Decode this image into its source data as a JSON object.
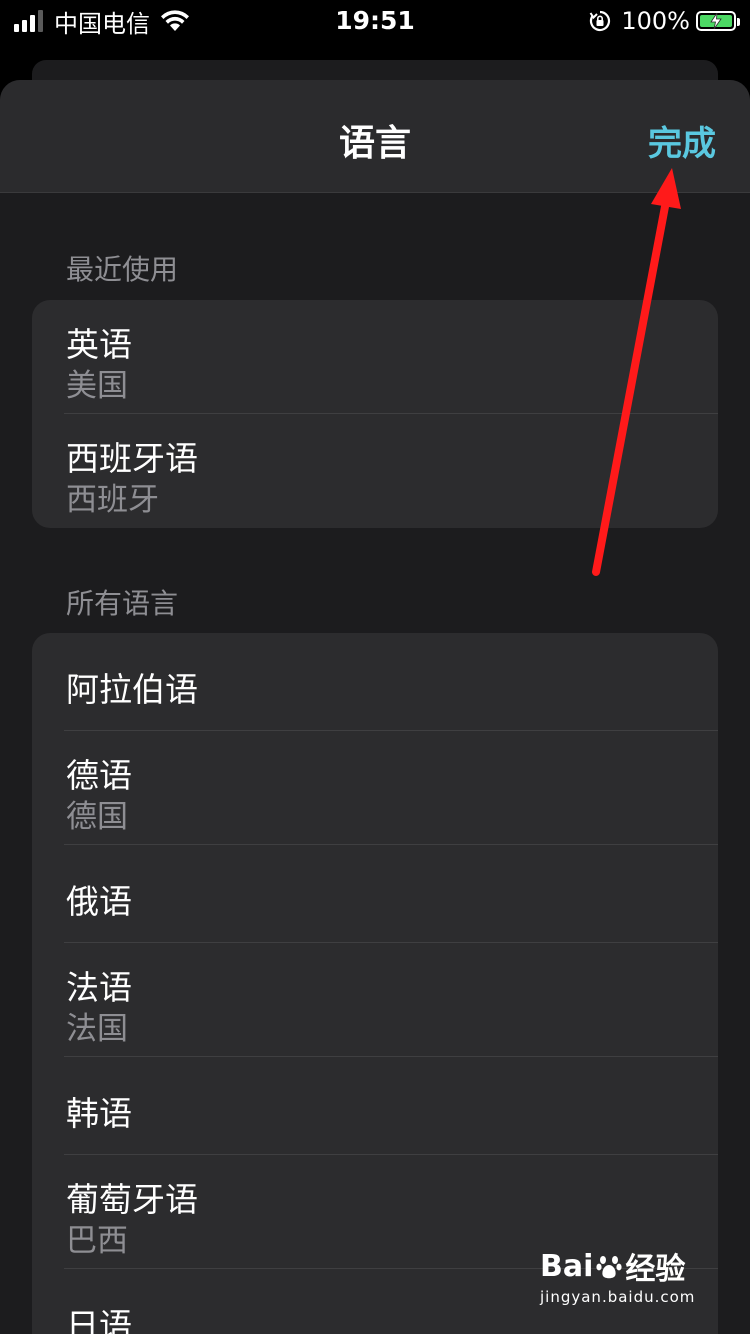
{
  "status_bar": {
    "carrier": "中国电信",
    "time": "19:51",
    "battery_percent": "100%"
  },
  "sheet": {
    "title": "语言",
    "done_label": "完成"
  },
  "recent": {
    "header": "最近使用",
    "items": [
      {
        "title": "英语",
        "subtitle": "美国"
      },
      {
        "title": "西班牙语",
        "subtitle": "西班牙"
      }
    ]
  },
  "all": {
    "header": "所有语言",
    "items": [
      {
        "title": "阿拉伯语",
        "subtitle": ""
      },
      {
        "title": "德语",
        "subtitle": "德国"
      },
      {
        "title": "俄语",
        "subtitle": ""
      },
      {
        "title": "法语",
        "subtitle": "法国"
      },
      {
        "title": "韩语",
        "subtitle": ""
      },
      {
        "title": "葡萄牙语",
        "subtitle": "巴西"
      },
      {
        "title": "日语",
        "subtitle": ""
      }
    ]
  },
  "watermark": {
    "brand_left": "Bai",
    "brand_right": "经验",
    "url": "jingyan.baidu.com"
  },
  "colors": {
    "accent": "#5ac8e0",
    "annotation_arrow": "#ff1a1a",
    "battery_fill": "#4cd964"
  },
  "icons": [
    "signal-icon",
    "wifi-icon",
    "rotation-lock-icon",
    "battery-charging-icon",
    "baidu-paw-icon"
  ]
}
